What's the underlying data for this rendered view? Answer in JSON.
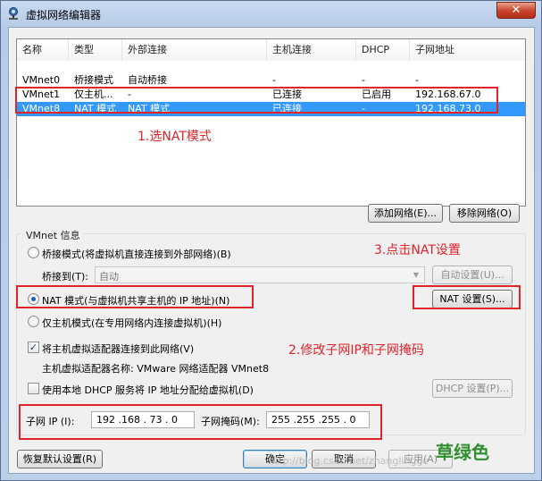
{
  "window": {
    "title": "虚拟网络编辑器",
    "close_glyph": "✕"
  },
  "table": {
    "headers": [
      "名称",
      "类型",
      "外部连接",
      "主机连接",
      "DHCP",
      "子网地址"
    ],
    "rows": [
      {
        "name": "VMnet0",
        "type": "桥接模式",
        "external": "自动桥接",
        "host": "-",
        "dhcp": "-",
        "subnet": "-"
      },
      {
        "name": "VMnet1",
        "type": "仅主机...",
        "external": "-",
        "host": "已连接",
        "dhcp": "已启用",
        "subnet": "192.168.67.0"
      },
      {
        "name": "VMnet8",
        "type": "NAT 模式",
        "external": "NAT 模式",
        "host": "已连接",
        "dhcp": "-",
        "subnet": "192.168.73.0"
      }
    ],
    "selected_row": 2
  },
  "buttons": {
    "add_network": "添加网络(E)...",
    "remove_network": "移除网络(O)",
    "auto_settings": "自动设置(U)...",
    "nat_settings": "NAT 设置(S)...",
    "dhcp_settings": "DHCP 设置(P)...",
    "restore_defaults": "恢复默认设置(R)",
    "ok": "确定",
    "cancel": "取消",
    "apply": "应用(A)"
  },
  "vmnet_info": {
    "group_title": "VMnet 信息",
    "bridged_label": "桥接模式(将虚拟机直接连接到外部网络)(B)",
    "bridged_to_label": "桥接到(T):",
    "bridged_to_value": "自动",
    "nat_label": "NAT 模式(与虚拟机共享主机的 IP 地址)(N)",
    "hostonly_label": "仅主机模式(在专用网络内连接虚拟机)(H)",
    "selected_mode": "nat",
    "connect_adapter_label": "将主机虚拟适配器连接到此网络(V)",
    "connect_adapter_checked": true,
    "adapter_name_label": "主机虚拟适配器名称: VMware 网络适配器 VMnet8",
    "dhcp_label": "使用本地 DHCP 服务将 IP 地址分配给虚拟机(D)",
    "dhcp_checked": false,
    "subnet_ip_label": "子网 IP (I):",
    "subnet_ip_value": "192 .168 . 73 . 0",
    "subnet_mask_label": "子网掩码(M):",
    "subnet_mask_value": "255 .255 .255 . 0"
  },
  "annotations": {
    "step1": "1.选NAT模式",
    "step2": "2.修改子网IP和子网掩码",
    "step3": "3.点击NAT设置",
    "color": "#e2232a"
  },
  "watermark": {
    "text": "草绿色",
    "url": "http://blog.csdn.net/zhanglingge"
  },
  "colors": {
    "selection": "#3399ff",
    "title_gradient": "#c9daf0",
    "watermark": "#2f8f2f"
  }
}
